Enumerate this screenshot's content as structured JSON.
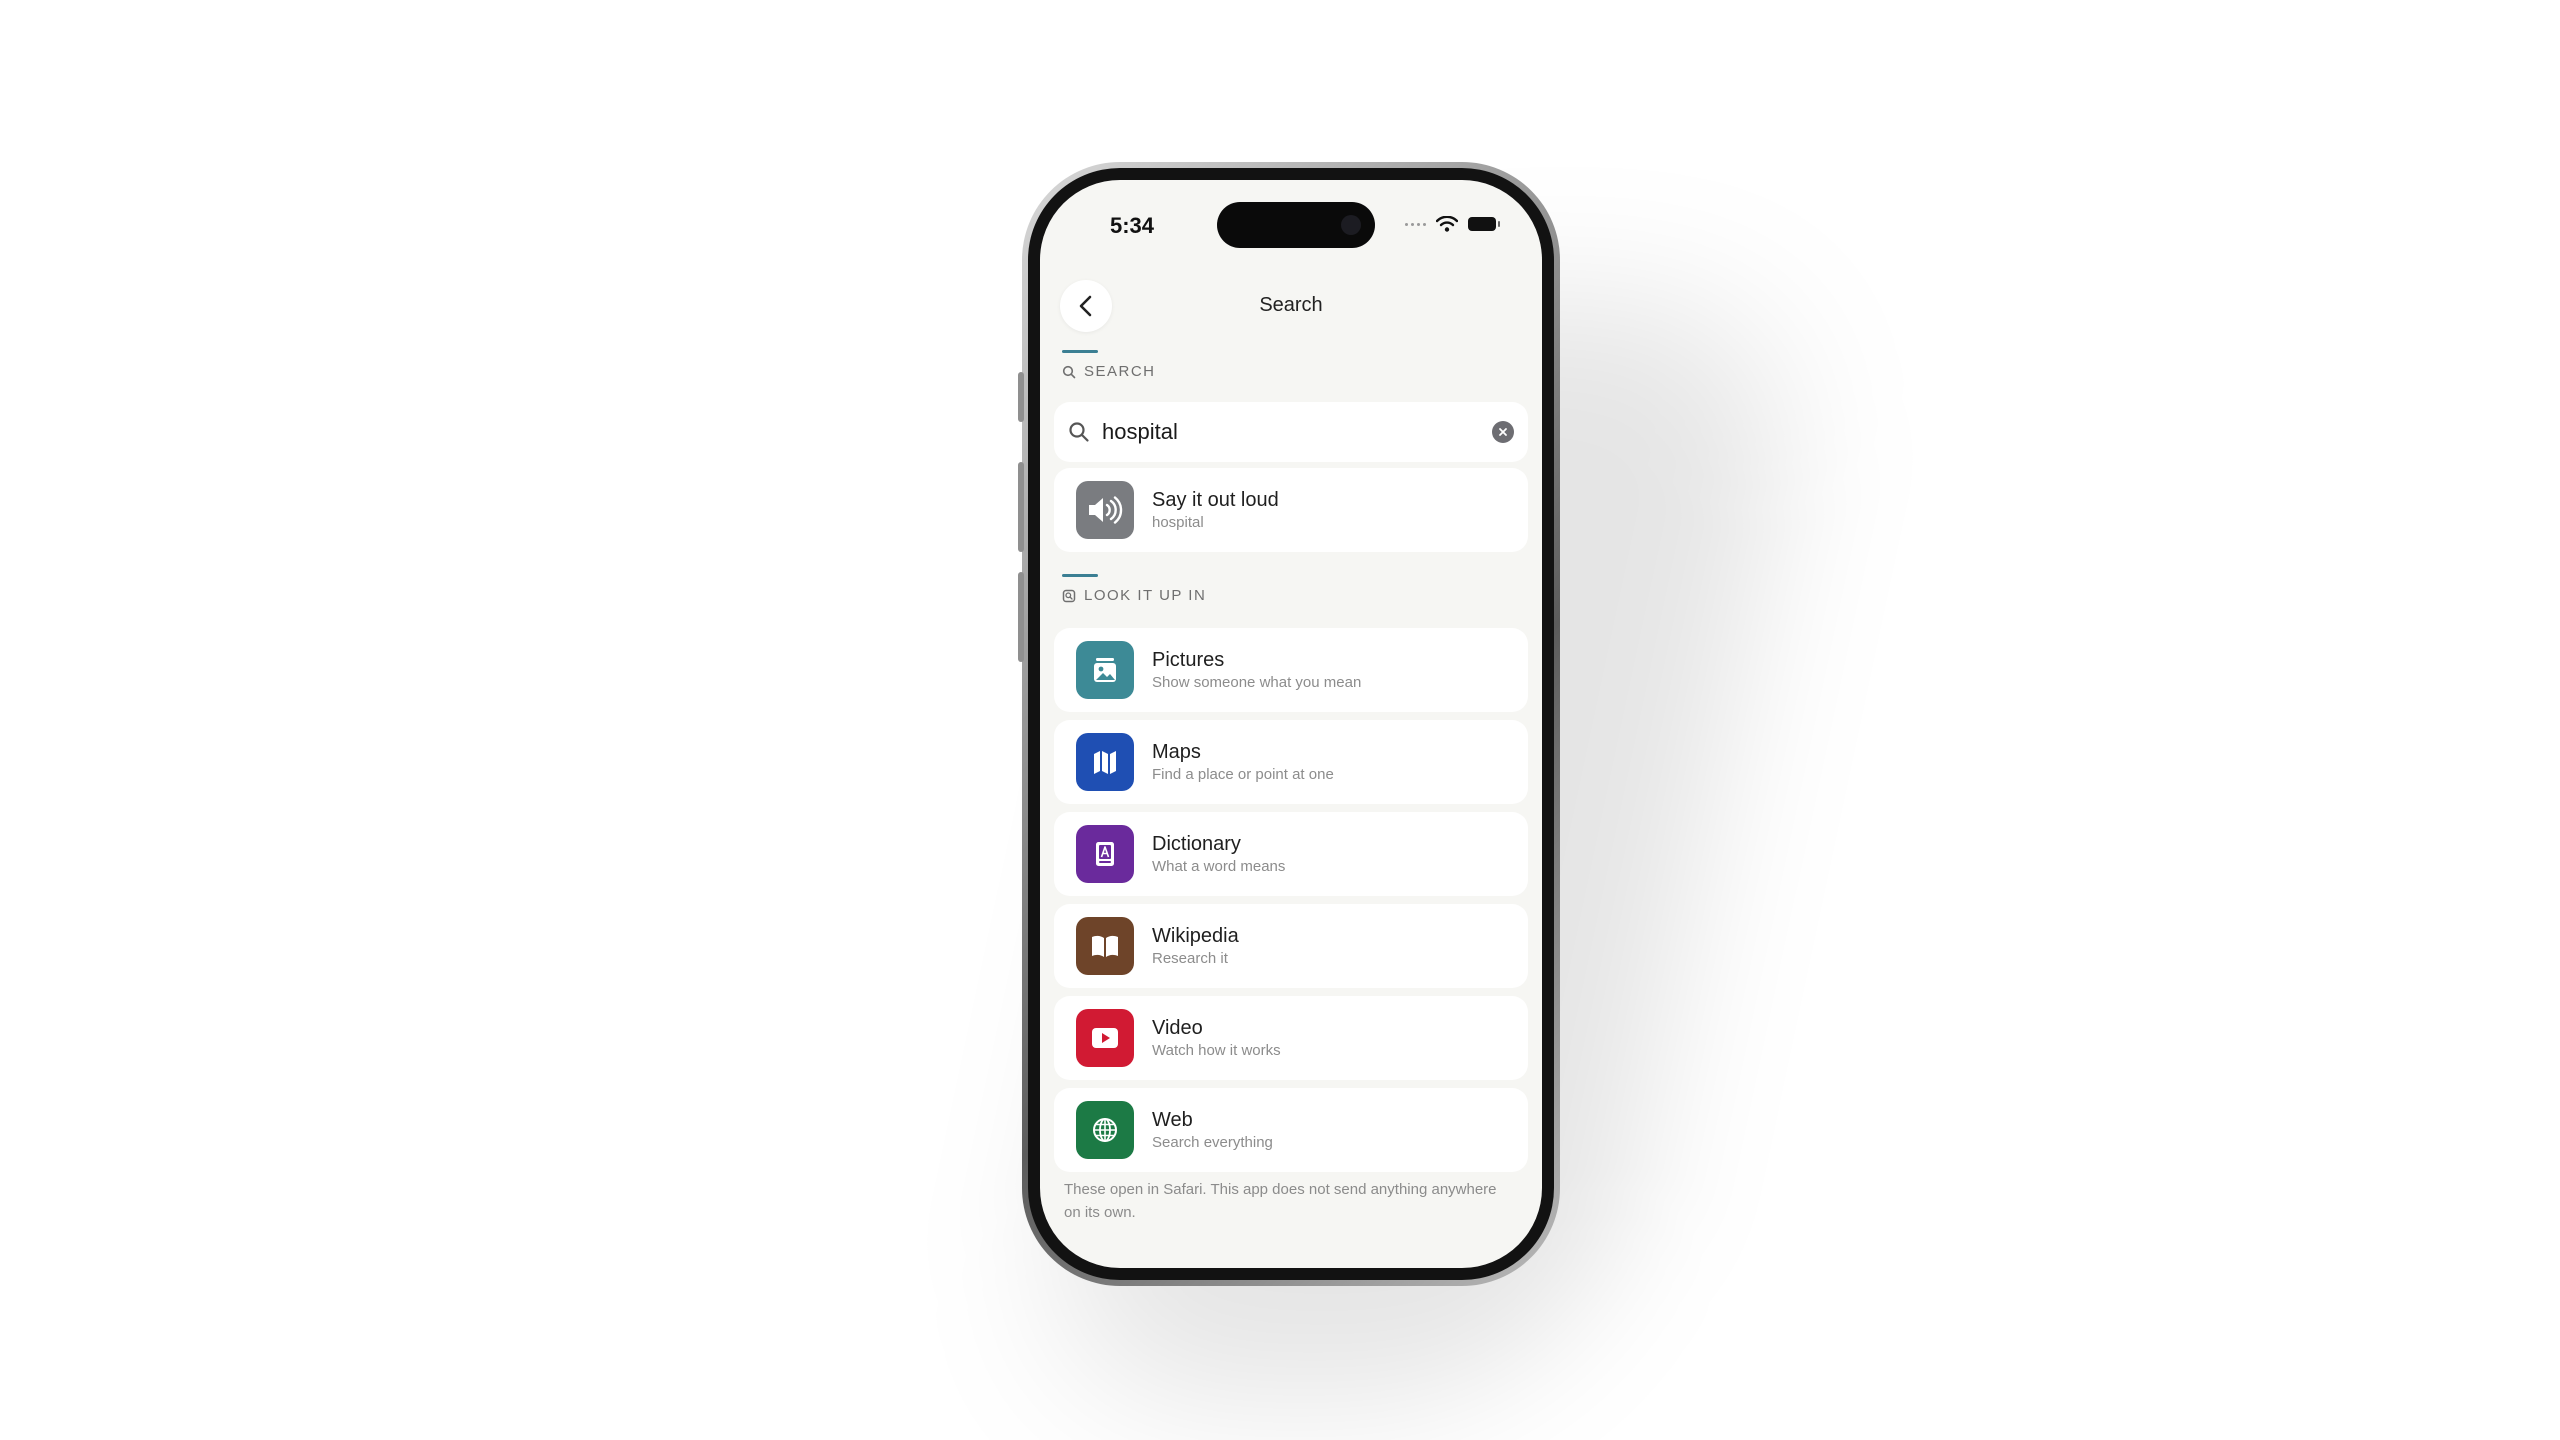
{
  "status_bar": {
    "time": "5:34"
  },
  "nav": {
    "title": "Search"
  },
  "search_section": {
    "label": "SEARCH",
    "query": "hospital"
  },
  "speak": {
    "title": "Say it out loud",
    "subtitle": "hospital",
    "icon": "speaker-icon",
    "color": "#7a7c80"
  },
  "lookup_section": {
    "label": "LOOK IT UP IN"
  },
  "lookup_items": [
    {
      "title": "Pictures",
      "subtitle": "Show someone what you mean",
      "icon": "pictures-icon",
      "color": "#3d8a96"
    },
    {
      "title": "Maps",
      "subtitle": "Find a place or point at one",
      "icon": "map-icon",
      "color": "#1f4fb3"
    },
    {
      "title": "Dictionary",
      "subtitle": "What a word means",
      "icon": "dictionary-icon",
      "color": "#6a2a9c"
    },
    {
      "title": "Wikipedia",
      "subtitle": "Research it",
      "icon": "book-icon",
      "color": "#6e4429"
    },
    {
      "title": "Video",
      "subtitle": "Watch how it works",
      "icon": "play-icon",
      "color": "#d11a33"
    },
    {
      "title": "Web",
      "subtitle": "Search everything",
      "icon": "globe-icon",
      "color": "#1c7a45"
    }
  ],
  "footer": {
    "note": "These open in Safari. This app does not send anything anywhere on its own."
  }
}
